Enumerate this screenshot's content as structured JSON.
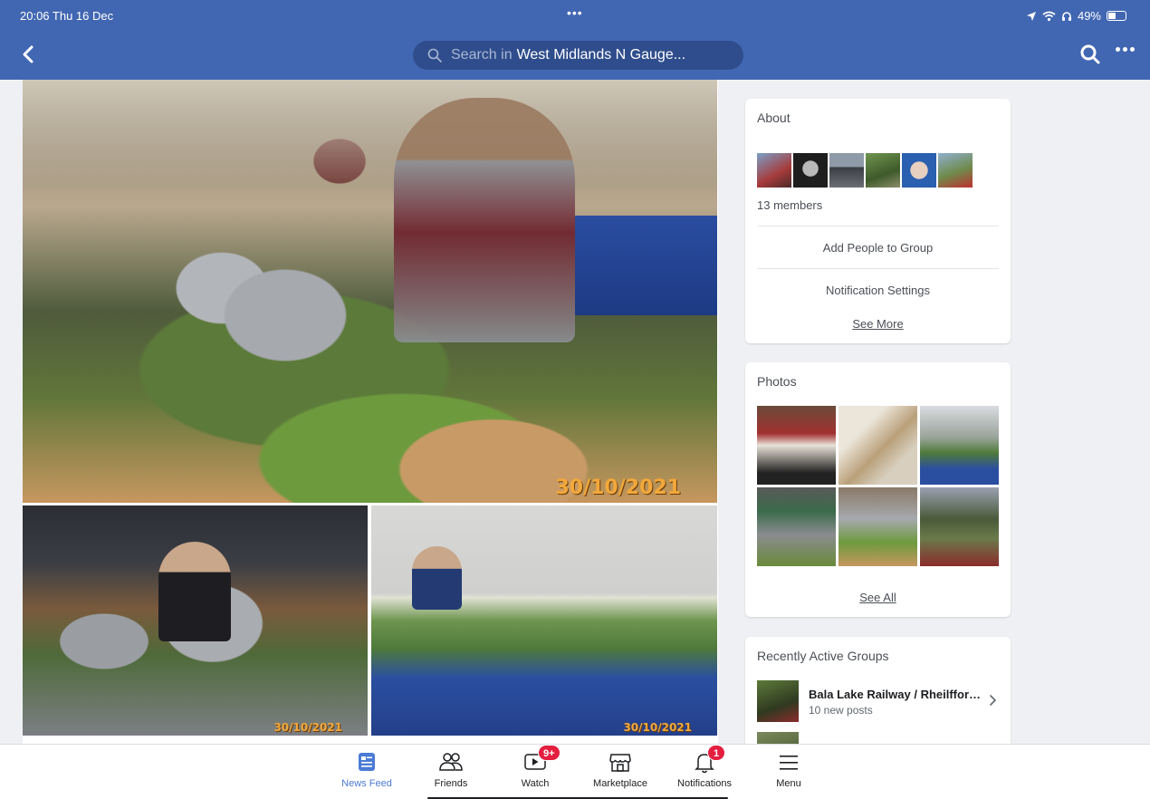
{
  "status_bar": {
    "time_date": "20:06  Thu 16 Dec",
    "dots": "•••",
    "battery": "49%",
    "battery_level": 0.49
  },
  "header": {
    "search_placeholder": "Search in",
    "group_name": "West Midlands N Gauge...",
    "icons": [
      "back-chevron-icon",
      "search-icon",
      "more-icon"
    ],
    "color": "#4267b2"
  },
  "post": {
    "photo_dates": [
      "30/10/2021",
      "30/10/2021",
      "30/10/2021"
    ]
  },
  "about": {
    "title": "About",
    "members": "13 members",
    "add_people": "Add People to Group",
    "notification_settings": "Notification Settings",
    "see_more": "See More"
  },
  "photos": {
    "title": "Photos",
    "see_all": "See All"
  },
  "recent_groups": {
    "title": "Recently Active Groups",
    "items": [
      {
        "name": "Bala Lake Railway / Rheilfford...",
        "sub": "10 new posts"
      }
    ]
  },
  "tabbar": {
    "tabs": [
      {
        "label": "News Feed",
        "icon": "news-feed-icon",
        "active": true
      },
      {
        "label": "Friends",
        "icon": "friends-icon"
      },
      {
        "label": "Watch",
        "icon": "watch-icon",
        "badge": "9+"
      },
      {
        "label": "Marketplace",
        "icon": "marketplace-icon"
      },
      {
        "label": "Notifications",
        "icon": "bell-icon",
        "badge": "1"
      },
      {
        "label": "Menu",
        "icon": "menu-icon"
      }
    ],
    "active_color": "#4b7bd6",
    "badge_color": "#e41e3f"
  }
}
